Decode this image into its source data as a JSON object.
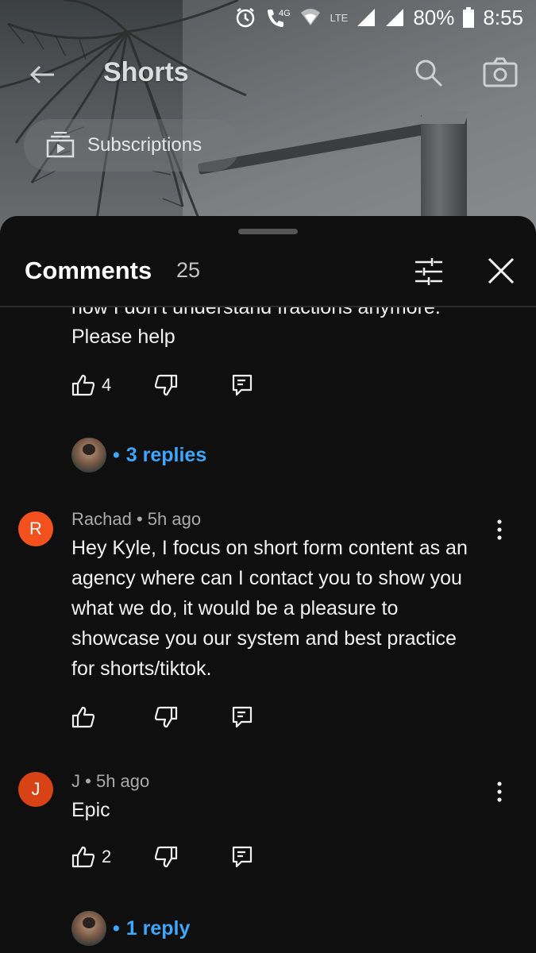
{
  "status_bar": {
    "network_4g": "4G",
    "network_lte": "LTE",
    "battery": "80%",
    "time": "8:55"
  },
  "top_bar": {
    "title": "Shorts",
    "subscriptions_label": "Subscriptions"
  },
  "comments_sheet": {
    "title": "Comments",
    "count": "25",
    "comments": [
      {
        "truncated_line": "now I don't understand fractions anymore.",
        "text": "Please help",
        "likes": "4",
        "replies_label": "3 replies"
      },
      {
        "avatar_letter": "R",
        "author": "Rachad",
        "time": "5h ago",
        "text_lines": [
          "Hey Kyle, I focus on short form content as an",
          "agency where can I contact you to show you",
          "what we do, it would be a pleasure to",
          "showcase you our system and best practice",
          "for shorts/tiktok."
        ],
        "likes": ""
      },
      {
        "avatar_letter": "J",
        "author": "J",
        "time": "5h ago",
        "text": "Epic",
        "likes": "2",
        "replies_label": "1 reply"
      }
    ]
  },
  "separator": "•"
}
